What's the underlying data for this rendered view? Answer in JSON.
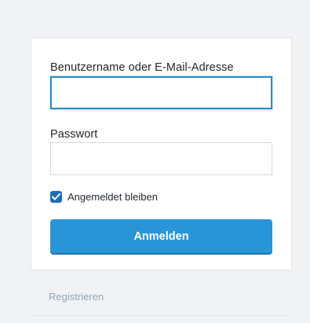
{
  "login_form": {
    "username_label": "Benutzername oder E-Mail-Adresse",
    "username_value": "",
    "password_label": "Passwort",
    "password_value": "",
    "remember_label": "Angemeldet bleiben",
    "remember_checked": true,
    "submit_label": "Anmelden"
  },
  "footer": {
    "register_label": "Registrieren"
  },
  "colors": {
    "accent": "#2a95d6",
    "focus_border": "#2f8bc6",
    "checkbox": "#1e6fb8",
    "link": "#8fa6b8",
    "background": "#f1f2f4"
  },
  "icons": {
    "checkbox": "checkmark-icon"
  }
}
